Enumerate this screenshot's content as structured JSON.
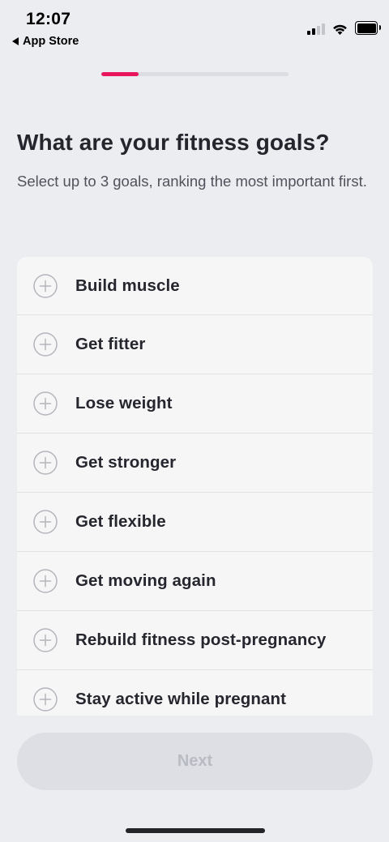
{
  "status_bar": {
    "time": "12:07",
    "back_app": "App Store"
  },
  "progress": {
    "value": 0.2,
    "color": "#e8175d"
  },
  "header": {
    "title": "What are your fitness goals?",
    "subtitle": "Select up to 3 goals, ranking the most important first."
  },
  "goals": [
    {
      "label": "Build muscle",
      "icon": "plus-circle-icon"
    },
    {
      "label": "Get fitter",
      "icon": "plus-circle-icon"
    },
    {
      "label": "Lose weight",
      "icon": "plus-circle-icon"
    },
    {
      "label": "Get stronger",
      "icon": "plus-circle-icon"
    },
    {
      "label": "Get flexible",
      "icon": "plus-circle-icon"
    },
    {
      "label": "Get moving again",
      "icon": "plus-circle-icon"
    },
    {
      "label": "Rebuild fitness post-pregnancy",
      "icon": "plus-circle-icon"
    },
    {
      "label": "Stay active while pregnant",
      "icon": "plus-circle-icon"
    }
  ],
  "footer": {
    "next_label": "Next",
    "next_enabled": false
  },
  "colors": {
    "background": "#ecedf1",
    "card": "#f6f6f7",
    "accent": "#e8175d",
    "button_disabled": "#dedfe5",
    "button_disabled_text": "#b9bbc3"
  }
}
